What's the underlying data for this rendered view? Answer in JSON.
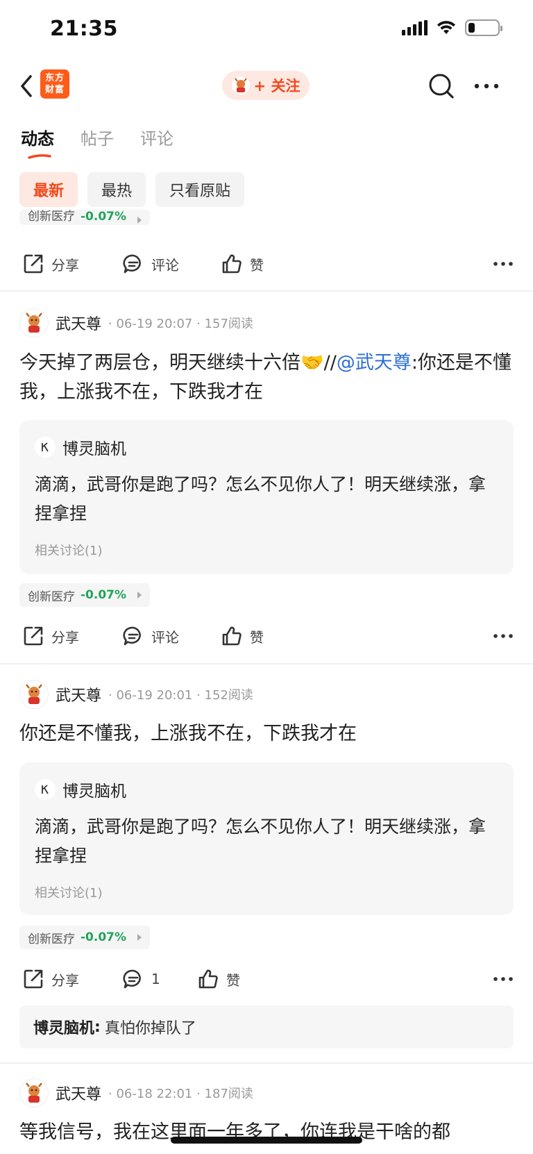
{
  "status_bar": {
    "time": "21:35"
  },
  "nav": {
    "logo_line1": "东方",
    "logo_line2": "财富",
    "follow_label": "+ 关注"
  },
  "tabs": [
    {
      "label": "动态",
      "active": true
    },
    {
      "label": "帖子",
      "active": false
    },
    {
      "label": "评论",
      "active": false
    }
  ],
  "filters": [
    {
      "label": "最新",
      "active": true
    },
    {
      "label": "最热",
      "active": false
    },
    {
      "label": "只看原贴",
      "active": false
    }
  ],
  "actions": {
    "share": "分享",
    "comment": "评论",
    "like": "赞"
  },
  "posts": [
    {
      "stock_tag": {
        "name": "创新医疗",
        "change": "-0.07%"
      }
    },
    {
      "author": "武天尊",
      "time": "06-19 20:07",
      "reads": "157阅读",
      "text_before": "今天掉了两层仓，明天继续十六倍🤝//",
      "mention": "@武天尊",
      "text_after": ":你还是不懂我，上涨我不在，下跌我才在",
      "quote": {
        "author": "博灵脑机",
        "text": "滴滴，武哥你是跑了吗？怎么不见你人了！明天继续涨，拿捏拿捏",
        "related": "相关讨论(1)"
      },
      "stock_tag": {
        "name": "创新医疗",
        "change": "-0.07%"
      }
    },
    {
      "author": "武天尊",
      "time": "06-19 20:01",
      "reads": "152阅读",
      "text": "你还是不懂我，上涨我不在，下跌我才在",
      "quote": {
        "author": "博灵脑机",
        "text": "滴滴，武哥你是跑了吗？怎么不见你人了！明天继续涨，拿捏拿捏",
        "related": "相关讨论(1)"
      },
      "stock_tag": {
        "name": "创新医疗",
        "change": "-0.07%"
      },
      "comment_count": "1",
      "reply": {
        "author": "博灵脑机",
        "text": "真怕你掉队了"
      }
    },
    {
      "author": "武天尊",
      "time": "06-18 22:01",
      "reads": "187阅读",
      "text": "等我信号，我在这里面一年多了，你连我是干啥的都"
    }
  ],
  "colors": {
    "brand": "#ff5c1a",
    "accent": "#f24a1d",
    "down_green": "#22a35a",
    "mention_blue": "#2c6fd6"
  }
}
